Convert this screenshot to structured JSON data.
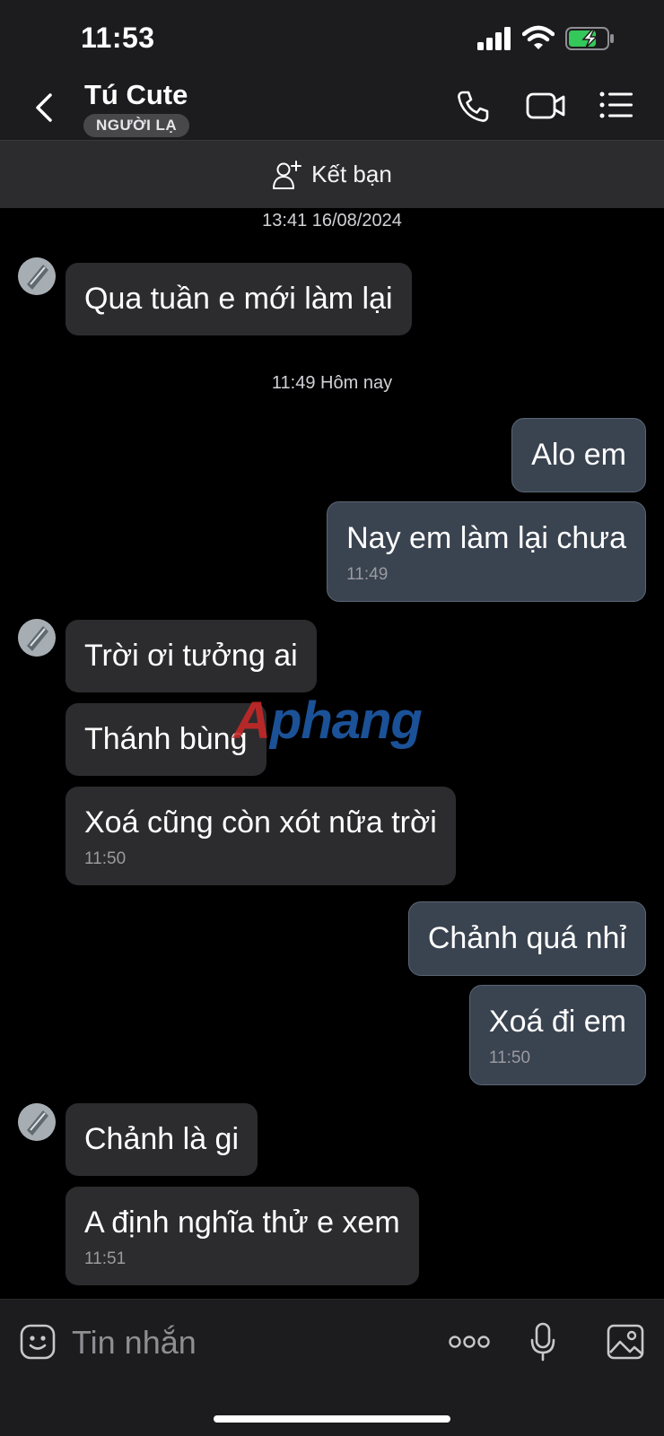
{
  "status_bar": {
    "time": "11:53"
  },
  "header": {
    "contact_name": "Tú Cute",
    "badge": "NGƯỜI LẠ",
    "icons": [
      "back-icon",
      "phone-icon",
      "video-call-icon",
      "menu-list-icon"
    ]
  },
  "friend_bar": {
    "label": "Kết bạn",
    "icon": "add-friend-icon"
  },
  "messages": [
    {
      "type": "stamp",
      "text": "13:41 16/08/2024"
    },
    {
      "type": "in",
      "text": "Qua tuần e mới làm lại"
    },
    {
      "type": "stamp",
      "text": "11:49 Hôm nay"
    },
    {
      "type": "out",
      "text": "Alo em"
    },
    {
      "type": "out",
      "text": "Nay em làm lại chưa",
      "time": "11:49"
    },
    {
      "type": "in",
      "text": "Trời ơi tưởng ai"
    },
    {
      "type": "in",
      "text": "Thánh bùng"
    },
    {
      "type": "in",
      "text": "Xoá cũng còn xót nữa trời",
      "time": "11:50"
    },
    {
      "type": "out",
      "text": "Chảnh quá nhỉ"
    },
    {
      "type": "out",
      "text": "Xoá đi em",
      "time": "11:50"
    },
    {
      "type": "in",
      "text": "Chảnh là gi"
    },
    {
      "type": "in",
      "text": "A định nghĩa thử e xem",
      "time": "11:51"
    }
  ],
  "watermark": {
    "first": "A",
    "rest": "phang"
  },
  "input_bar": {
    "placeholder": "Tin nhắn",
    "icons": [
      "sticker-icon",
      "more-icon",
      "microphone-icon",
      "image-icon"
    ]
  },
  "colors": {
    "incoming_bubble": "#2c2c2e",
    "outgoing_bubble": "#3a4350",
    "background": "#000000"
  }
}
